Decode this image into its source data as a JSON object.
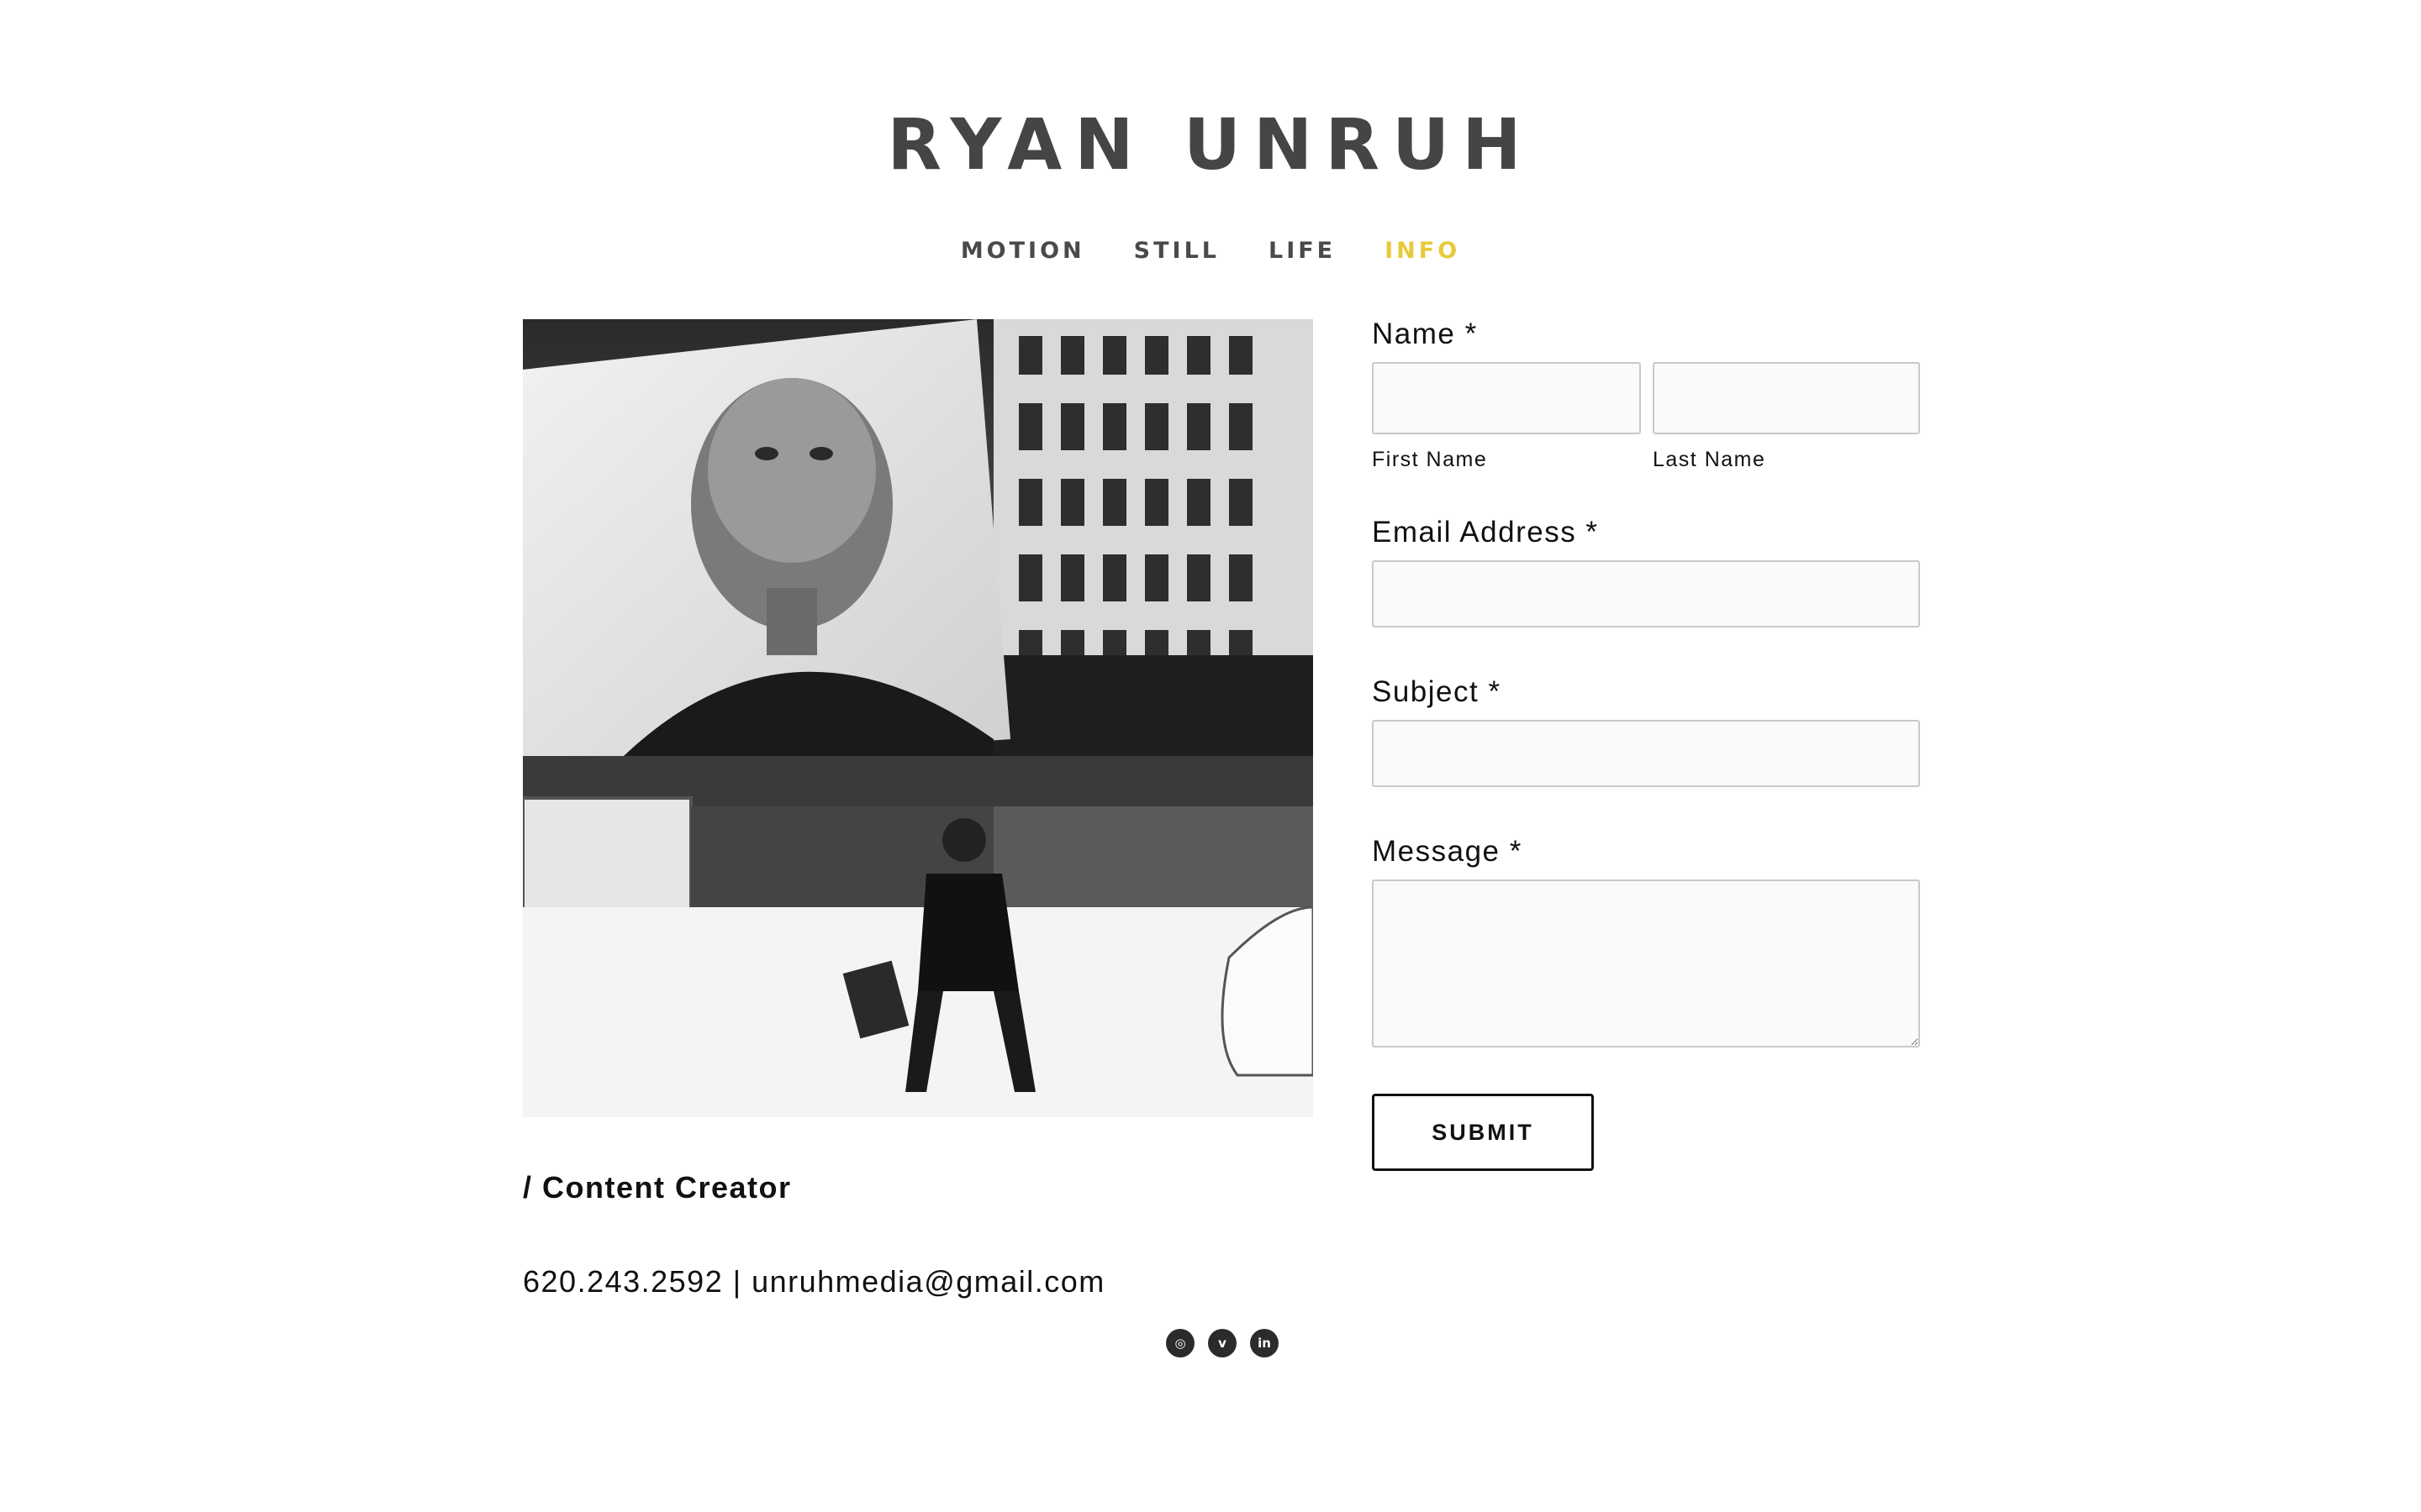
{
  "site": {
    "title": "RYAN UNRUH"
  },
  "nav": {
    "items": [
      {
        "label": "MOTION"
      },
      {
        "label": "STILL"
      },
      {
        "label": "LIFE"
      },
      {
        "label": "INFO"
      }
    ],
    "active_item": "INFO",
    "active_color": "#e8c93a"
  },
  "profile": {
    "role": "/ Content Creator",
    "contact": "620.243.2592 | unruhmedia@gmail.com",
    "photo_alt": "Black and white street photo in snowy city with large billboard portrait"
  },
  "social": {
    "icons": [
      "instagram-icon",
      "vimeo-icon",
      "linkedin-icon"
    ]
  },
  "form": {
    "name_label": "Name *",
    "first_name_label": "First Name",
    "first_name_value": "",
    "last_name_label": "Last Name",
    "last_name_value": "",
    "email_label": "Email Address *",
    "email_value": "",
    "subject_label": "Subject *",
    "subject_value": "",
    "message_label": "Message *",
    "message_value": "",
    "submit_label": "SUBMIT"
  }
}
